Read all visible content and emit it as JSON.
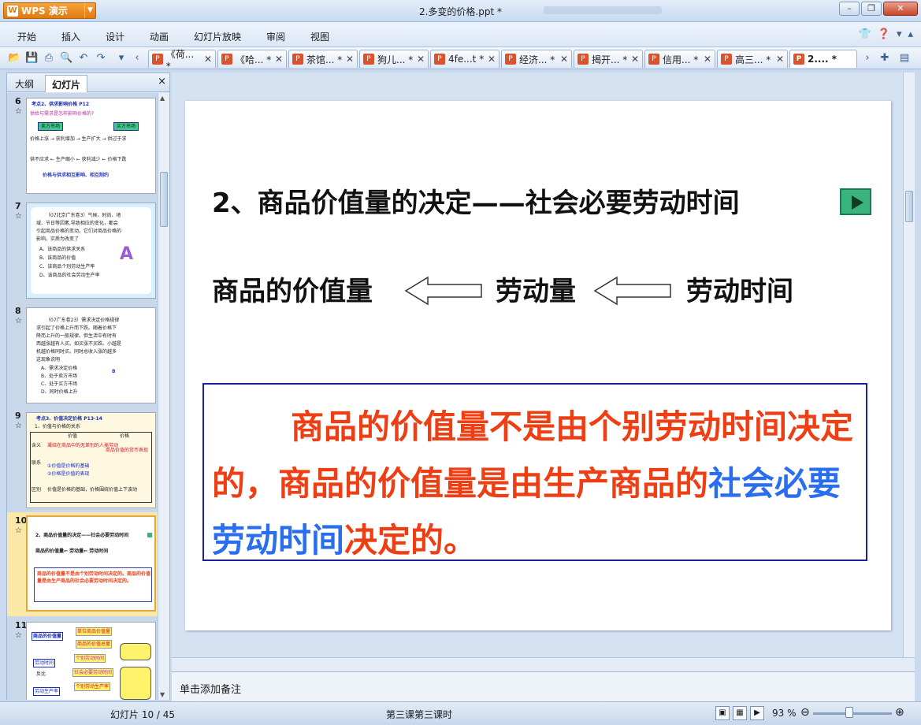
{
  "app": {
    "name": "WPS 演示",
    "logo": "W",
    "doc_title": "2.多变的价格.ppt *"
  },
  "menu": [
    "开始",
    "插入",
    "设计",
    "动画",
    "幻灯片放映",
    "审阅",
    "视图"
  ],
  "tabs": [
    {
      "label": "《荷...  *"
    },
    {
      "label": "《哈...  *"
    },
    {
      "label": "茶馆...  *"
    },
    {
      "label": "狗儿...  *"
    },
    {
      "label": "4fe...t  *"
    },
    {
      "label": "经济...  *"
    },
    {
      "label": "揭开...  *"
    },
    {
      "label": "信用...  *"
    },
    {
      "label": "高三...  *"
    },
    {
      "label": "2....  *"
    }
  ],
  "left_panel": {
    "tab_outline": "大纲",
    "tab_slides": "幻灯片",
    "close": "×"
  },
  "thumbs": {
    "s6": {
      "num": "6",
      "t1": "考点2、供求影响价格  P12",
      "t2": "供给与需求是怎样影响价格的?",
      "b1": "卖方市场",
      "b2": "买方市场",
      "t3": "价格上涨 → 获利增加 → 生产扩大 → 供过于求",
      "t4": "供不应求 ← 生产缩小 ← 获利减少 ← 价格下跌",
      "t5": "价格与供求相互影响、相互制约"
    },
    "s7": {
      "num": "7",
      "lines": [
        "（07北京广东卷3）气候、时尚、地",
        "域、节日等因素,导致相应的变化，都会",
        "引起商品价格的变动。它们对商品价格的",
        "影响，实质为改变了",
        "A、该商品的供求关系",
        "B、该商品的价值",
        "C、该商品个别劳动生产率",
        "D、该商品的社会劳动生产率"
      ]
    },
    "s8": {
      "num": "8",
      "lines": [
        "（07广东卷23）需求决定价格规律",
        "求引起了价格上升而下跌。随着价格下",
        "降而上升的一般规律。但生活中有时有",
        "西越涨越有人买。如买涨不买跌。小越是",
        "机越价格同时买。同时总收入涨的越多",
        "这现象说明",
        "A、需求决定价格",
        "B、处于卖方市场",
        "C、处于买方市场",
        "D、同时价格上升"
      ],
      "answer": "B"
    },
    "s9": {
      "num": "9",
      "t1": "考点3、价值决定价格  P13-14",
      "t2": "1、价值与价格的关系",
      "h1": "价值",
      "h2": "价格",
      "r1": "含义",
      "r1a": "凝结在商品中的无差别的人类劳动",
      "r1b": "商品价值的货币表现",
      "r2": "联系",
      "r2a": "①价值是价格的基础",
      "r2b": "②价格是价值的表现",
      "r3": "区别",
      "r3a": "价值是价格的基础，价格围绕价值上下波动"
    },
    "s10": {
      "num": "10",
      "title": "2、商品价值量的决定——社会必要劳动时间",
      "row": "商品的价值量⇐ 劳动量⇐ 劳动时间",
      "para": "商品的价值量不是由个别劳动时间决定的。商品的价值量是由生产商品的社会必要劳动时间决定的。"
    },
    "s11": {
      "num": "11",
      "b1": "商品的价值量",
      "b2": "单位商品价值量",
      "b3": "商品的价值总量",
      "b4": "个别劳动时间",
      "b5": "社会必要劳动时间",
      "b6": "个别劳动生产率",
      "t1": "劳动时间",
      "t2": "反比",
      "t3": "劳动生产率"
    }
  },
  "slide": {
    "title": "2、商品价值量的决定——社会必要劳动时间",
    "row_a": "商品的价值量",
    "row_b": "劳动量",
    "row_c": "劳动时间",
    "para_red1": "商品的价值量不是由个别劳动时间决定的，商品的价值量是由生产商品的",
    "para_blue": "社会必要劳动时间",
    "para_red2": "决定的。"
  },
  "notes_placeholder": "单击添加备注",
  "status": {
    "slide_pos": "幻灯片 10 / 45",
    "theme": "第三课第三课时",
    "zoom": "93 %"
  },
  "colors": {
    "title_red": "#ee3e14",
    "blue": "#2a6ef0",
    "box_border": "#1b1e9e",
    "play": "#3bb37e"
  }
}
